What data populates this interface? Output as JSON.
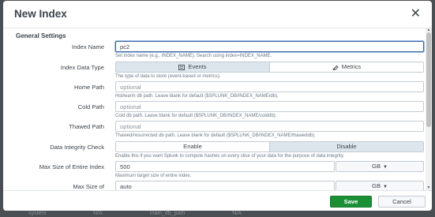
{
  "backdrop": {
    "row_items": [
      "system",
      "N/A",
      "main_db_path",
      "N/A"
    ]
  },
  "modal": {
    "title": "New Index",
    "close_glyph": "✕",
    "section_title": "General Settings",
    "fields": {
      "index_name": {
        "label": "Index Name",
        "value": "pc2",
        "help": "Set index name (e.g., INDEX_NAME). Search using index=INDEX_NAME."
      },
      "index_data_type": {
        "label": "Index Data Type",
        "options": [
          {
            "label": "Events",
            "icon": "events-icon",
            "selected": true
          },
          {
            "label": "Metrics",
            "icon": "metrics-icon",
            "selected": false
          }
        ],
        "help": "The type of data to store (event-based or metrics)."
      },
      "home_path": {
        "label": "Home Path",
        "placeholder": "optional",
        "help": "Hot/warm db path. Leave blank for default ($SPLUNK_DB/INDEX_NAME/db)."
      },
      "cold_path": {
        "label": "Cold Path",
        "placeholder": "optional",
        "help": "Cold db path. Leave blank for default ($SPLUNK_DB/INDEX_NAME/colddb)."
      },
      "thawed_path": {
        "label": "Thawed Path",
        "placeholder": "optional",
        "help": "Thawed/resurrected db path. Leave blank for default ($SPLUNK_DB/INDEX_NAME/thaweddb)."
      },
      "data_integrity": {
        "label": "Data Integrity Check",
        "options": [
          {
            "label": "Enable",
            "selected": false
          },
          {
            "label": "Disable",
            "selected": true
          }
        ],
        "help": "Enable this if you want Splunk to compute hashes on every slice of your data for the purpose of data integrity."
      },
      "max_size_entire": {
        "label": "Max Size of Entire Index",
        "value": "500",
        "unit": "GB",
        "help": "Maximum target size of entire index."
      },
      "max_size_bucket": {
        "label": "Max Size of",
        "value": "auto",
        "unit": "GB"
      }
    },
    "footer": {
      "save_label": "Save",
      "cancel_label": "Cancel"
    }
  },
  "colors": {
    "accent": "#3863a0",
    "save": "#1a9035",
    "active_segment": "#dde5ed"
  }
}
